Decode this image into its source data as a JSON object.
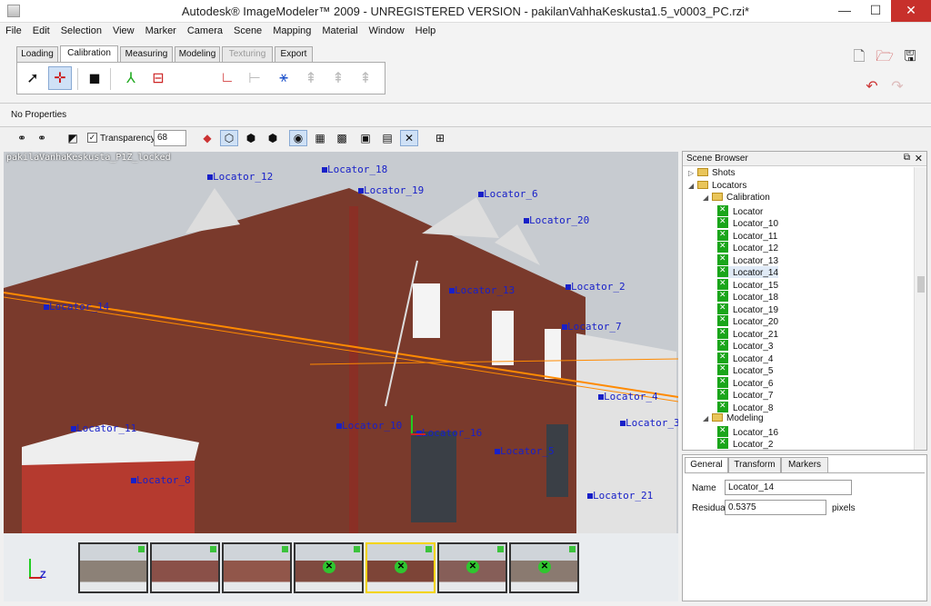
{
  "window": {
    "title": "Autodesk® ImageModeler™ 2009 - UNREGISTERED VERSION - pakilanVahhaKeskusta1.5_v0003_PC.rzi*",
    "min_icon": "minimize-icon",
    "max_icon": "maximize-icon",
    "close_glyph": "✕"
  },
  "menu": [
    "File",
    "Edit",
    "Selection",
    "View",
    "Marker",
    "Camera",
    "Scene",
    "Mapping",
    "Material",
    "Window",
    "Help"
  ],
  "tabs": [
    {
      "label": "Loading",
      "state": "normal"
    },
    {
      "label": "Calibration",
      "state": "active"
    },
    {
      "label": "Measuring",
      "state": "normal"
    },
    {
      "label": "Modeling",
      "state": "normal"
    },
    {
      "label": "Texturing",
      "state": "disabled"
    },
    {
      "label": "Export",
      "state": "normal"
    }
  ],
  "properties_bar": {
    "text": "No Properties"
  },
  "viewtools": {
    "transparency_label": "Transparency",
    "transparency_value": "68",
    "checked_mark": "✓"
  },
  "viewport": {
    "shot_caption": "pakilaVanhaKeskusta_P1Z_locked",
    "locators": [
      {
        "label": "Locator_18"
      },
      {
        "label": "Locator_19"
      },
      {
        "label": "Locator_12"
      },
      {
        "label": "Locator_6"
      },
      {
        "label": "Locator_20"
      },
      {
        "label": "Locator_2"
      },
      {
        "label": "Locator_7"
      },
      {
        "label": "Locator_4"
      },
      {
        "label": "Locator_3"
      },
      {
        "label": "Locator_11"
      },
      {
        "label": "Locator_10"
      },
      {
        "label": "Locator_8"
      },
      {
        "label": "Locator_5"
      },
      {
        "label": "Locator_21"
      },
      {
        "label": "Locator_16"
      },
      {
        "label": "Locator_13"
      },
      {
        "label": "Locator_14"
      }
    ],
    "axis_label": "Z"
  },
  "thumbnails": [
    {
      "name": "shot-1",
      "selected": false,
      "locked": false
    },
    {
      "name": "shot-2",
      "selected": false,
      "locked": false
    },
    {
      "name": "shot-3",
      "selected": false,
      "locked": false
    },
    {
      "name": "shot-4",
      "selected": false,
      "locked": true
    },
    {
      "name": "shot-5",
      "selected": true,
      "locked": true
    },
    {
      "name": "shot-6",
      "selected": false,
      "locked": true
    },
    {
      "name": "shot-7",
      "selected": false,
      "locked": true
    }
  ],
  "scene_browser": {
    "title": "Scene Browser",
    "tree": [
      {
        "label": "Shots",
        "level": 0,
        "kind": "folder",
        "expanded": false
      },
      {
        "label": "Locators",
        "level": 0,
        "kind": "folder",
        "expanded": true
      },
      {
        "label": "Calibration",
        "level": 1,
        "kind": "folder",
        "expanded": true
      },
      {
        "label": "Locator",
        "level": 2,
        "kind": "locator"
      },
      {
        "label": "Locator_10",
        "level": 2,
        "kind": "locator"
      },
      {
        "label": "Locator_11",
        "level": 2,
        "kind": "locator"
      },
      {
        "label": "Locator_12",
        "level": 2,
        "kind": "locator"
      },
      {
        "label": "Locator_13",
        "level": 2,
        "kind": "locator"
      },
      {
        "label": "Locator_14",
        "level": 2,
        "kind": "locator",
        "selected": true
      },
      {
        "label": "Locator_15",
        "level": 2,
        "kind": "locator"
      },
      {
        "label": "Locator_18",
        "level": 2,
        "kind": "locator"
      },
      {
        "label": "Locator_19",
        "level": 2,
        "kind": "locator"
      },
      {
        "label": "Locator_20",
        "level": 2,
        "kind": "locator"
      },
      {
        "label": "Locator_21",
        "level": 2,
        "kind": "locator"
      },
      {
        "label": "Locator_3",
        "level": 2,
        "kind": "locator"
      },
      {
        "label": "Locator_4",
        "level": 2,
        "kind": "locator"
      },
      {
        "label": "Locator_5",
        "level": 2,
        "kind": "locator"
      },
      {
        "label": "Locator_6",
        "level": 2,
        "kind": "locator"
      },
      {
        "label": "Locator_7",
        "level": 2,
        "kind": "locator"
      },
      {
        "label": "Locator_8",
        "level": 2,
        "kind": "locator"
      },
      {
        "label": "Modeling",
        "level": 1,
        "kind": "folder",
        "expanded": true
      },
      {
        "label": "Locator_16",
        "level": 2,
        "kind": "locator"
      },
      {
        "label": "Locator_2",
        "level": 2,
        "kind": "locator"
      }
    ]
  },
  "properties": {
    "tabs": [
      "General",
      "Transform",
      "Markers"
    ],
    "active_tab": "General",
    "name_label": "Name",
    "name_value": "Locator_14",
    "residual_label": "Residual",
    "residual_value": "0.5375",
    "residual_unit": "pixels"
  },
  "colors": {
    "locator_blue": "#1820c8",
    "calibration_line_orange": "#ff8a00",
    "thumb_selected": "#f3d400",
    "lock_green": "#2fc62f"
  }
}
